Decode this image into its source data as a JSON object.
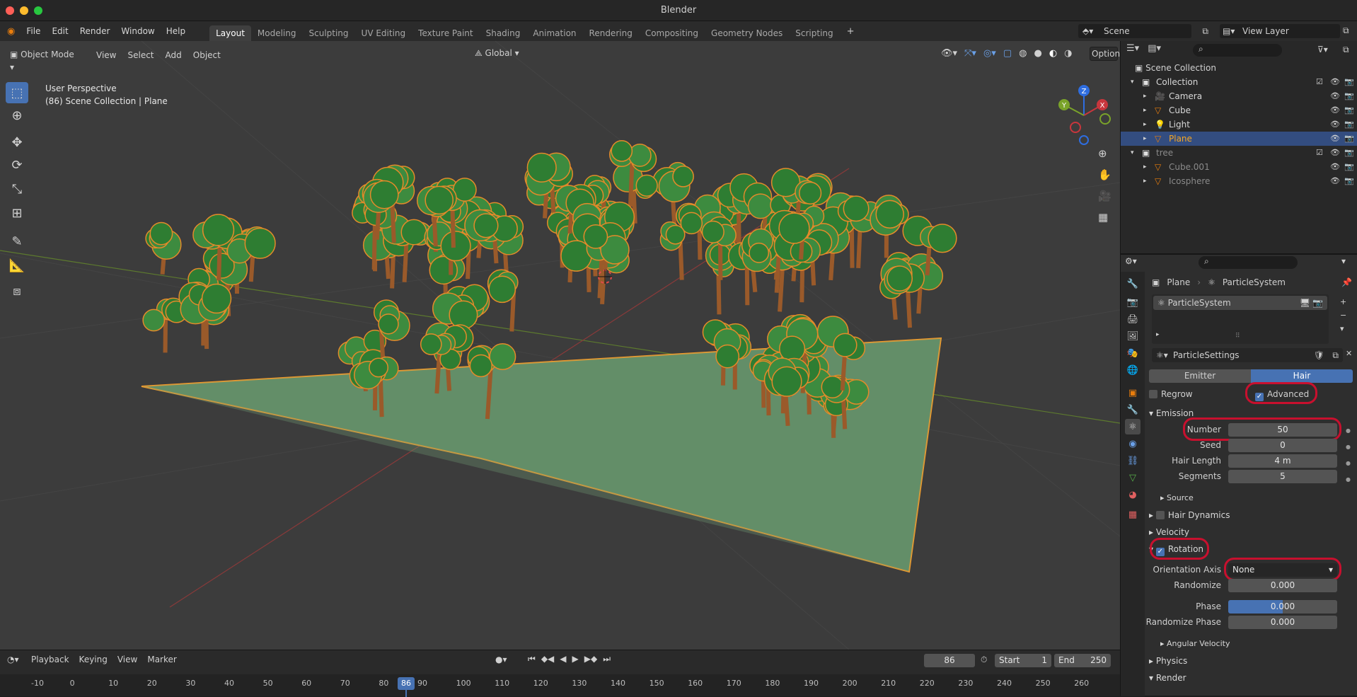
{
  "app": {
    "window_title": "Blender"
  },
  "topbar": {
    "menus": [
      "File",
      "Edit",
      "Render",
      "Window",
      "Help"
    ],
    "workspaces": [
      "Layout",
      "Modeling",
      "Sculpting",
      "UV Editing",
      "Texture Paint",
      "Shading",
      "Animation",
      "Rendering",
      "Compositing",
      "Geometry Nodes",
      "Scripting"
    ],
    "active_workspace": "Layout",
    "scene": "Scene",
    "view_layer": "View Layer"
  },
  "viewport_header": {
    "mode": "Object Mode",
    "menus": [
      "View",
      "Select",
      "Add",
      "Object"
    ],
    "orientation": "Global",
    "options_label": "Options"
  },
  "viewport": {
    "perspective_label": "User Perspective",
    "context_label": "(86) Scene Collection | Plane",
    "gizmo_axes": [
      "X",
      "Y",
      "Z"
    ]
  },
  "outliner": {
    "root": "Scene Collection",
    "items": [
      {
        "name": "Collection",
        "level": 0,
        "type": "collection"
      },
      {
        "name": "Camera",
        "level": 1,
        "type": "camera"
      },
      {
        "name": "Cube",
        "level": 1,
        "type": "mesh"
      },
      {
        "name": "Light",
        "level": 1,
        "type": "light"
      },
      {
        "name": "Plane",
        "level": 1,
        "type": "mesh",
        "selected": true
      },
      {
        "name": "tree",
        "level": 0,
        "type": "collection",
        "dim": true
      },
      {
        "name": "Cube.001",
        "level": 1,
        "type": "mesh",
        "dim": true
      },
      {
        "name": "Icosphere",
        "level": 1,
        "type": "mesh",
        "dim": true
      }
    ]
  },
  "properties": {
    "breadcrumb_object": "Plane",
    "breadcrumb_system": "ParticleSystem",
    "system_list_item": "ParticleSystem",
    "settings_name": "ParticleSettings",
    "type_emitter": "Emitter",
    "type_hair": "Hair",
    "regrow_label": "Regrow",
    "advanced_label": "Advanced",
    "emission": {
      "title": "Emission",
      "number_label": "Number",
      "number": "50",
      "seed_label": "Seed",
      "seed": "0",
      "hair_length_label": "Hair Length",
      "hair_length": "4 m",
      "segments_label": "Segments",
      "segments": "5",
      "source_label": "Source"
    },
    "hair_dynamics_label": "Hair Dynamics",
    "velocity_label": "Velocity",
    "rotation": {
      "title": "Rotation",
      "orientation_axis_label": "Orientation Axis",
      "orientation_axis": "None",
      "randomize_label": "Randomize",
      "randomize": "0.000",
      "phase_label": "Phase",
      "phase": "0.000",
      "randomize_phase_label": "Randomize Phase",
      "randomize_phase": "0.000",
      "angular_velocity_label": "Angular Velocity"
    },
    "physics_label": "Physics",
    "render_label": "Render"
  },
  "timeline": {
    "menus": [
      "Playback",
      "Keying",
      "View",
      "Marker"
    ],
    "current_frame": "86",
    "start_label": "Start",
    "start": "1",
    "end_label": "End",
    "end": "250",
    "ticks": [
      "-10",
      "0",
      "10",
      "20",
      "30",
      "40",
      "50",
      "60",
      "70",
      "80",
      "90",
      "100",
      "110",
      "120",
      "130",
      "140",
      "150",
      "160",
      "170",
      "180",
      "190",
      "200",
      "210",
      "220",
      "230",
      "240",
      "250",
      "260"
    ]
  },
  "colors": {
    "accent": "#4772b3",
    "selection_outline": "#f29b2b",
    "highlight_ring": "#c8102e"
  }
}
